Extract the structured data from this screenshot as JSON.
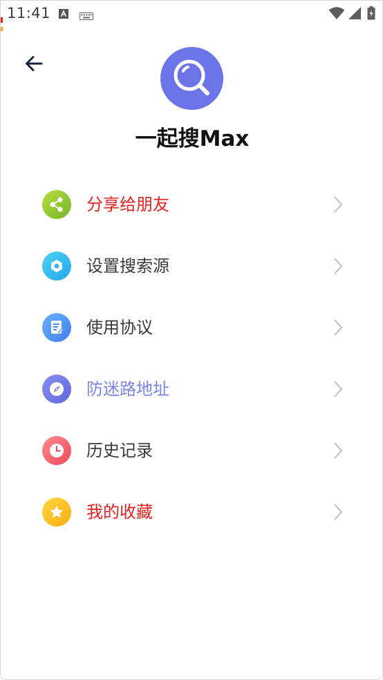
{
  "status_bar": {
    "time": "11:41",
    "icons": [
      "a-notification-icon",
      "keyboard-icon",
      "wifi-icon",
      "signal-icon",
      "battery-icon"
    ]
  },
  "header": {
    "back_icon": "arrow-left-icon",
    "logo_icon": "magnifier-icon",
    "title": "一起搜Max"
  },
  "colors": {
    "logo_bg": "#6b74e8",
    "label_default": "#3a3a3a",
    "label_red": "#e8211f",
    "label_purple": "#7c84ea",
    "chevron": "#bdbdbd"
  },
  "menu": {
    "items": [
      {
        "id": "share",
        "label": "分享给朋友",
        "icon": "share-icon",
        "label_color": "#e8211f"
      },
      {
        "id": "search-source",
        "label": "设置搜索源",
        "icon": "gear-icon",
        "label_color": "#3a3a3a"
      },
      {
        "id": "agreement",
        "label": "使用协议",
        "icon": "document-icon",
        "label_color": "#3a3a3a"
      },
      {
        "id": "address",
        "label": "防迷路地址",
        "icon": "compass-icon",
        "label_color": "#7c84ea"
      },
      {
        "id": "history",
        "label": "历史记录",
        "icon": "clock-icon",
        "label_color": "#3a3a3a"
      },
      {
        "id": "favorites",
        "label": "我的收藏",
        "icon": "star-icon",
        "label_color": "#e8211f"
      }
    ]
  }
}
